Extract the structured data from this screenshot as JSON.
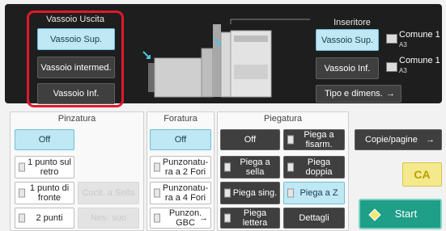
{
  "output_tray": {
    "title": "Vassoio Uscita",
    "options": [
      "Vassoio Sup.",
      "Vassoio intermed.",
      "Vassoio Inf."
    ],
    "selected": "Vassoio Sup."
  },
  "inserter": {
    "title": "Inseritore",
    "upper_button": "Vassoio Sup.",
    "upper_info": {
      "paper": "Comune 1",
      "size": "A3"
    },
    "lower_button": "Vassoio Inf.",
    "lower_info": {
      "paper": "Comune 1",
      "size": "A3"
    },
    "type_size_button": "Tipo e dimens."
  },
  "stapling": {
    "title": "Pinzatura",
    "off": "Off",
    "one_back": "1 punto sul retro",
    "one_front": "1 punto di fronte",
    "two_points": "2 punti",
    "saddle_disabled": "Cucit. a Sella",
    "none_disabled": "Nes- suo"
  },
  "punch": {
    "title": "Foratura",
    "off": "Off",
    "two_holes": "Punzonatu- ra a 2 Fori",
    "four_holes": "Punzonatu- ra a 4 Fori",
    "gbc": "Punzon. GBC"
  },
  "fold": {
    "title": "Piegatura",
    "off": "Off",
    "accordion": "Piega a fisarm.",
    "saddle": "Piega a sella",
    "double": "Piega doppia",
    "single": "Piega sing.",
    "z": "Piega a Z",
    "letter": "Piega lettera",
    "details": "Dettagli"
  },
  "actions": {
    "copies_pages": "Copie/pagine",
    "ca": "CA",
    "start": "Start"
  },
  "colors": {
    "selected": "#bfe7f4",
    "highlight_frame": "#e0182d",
    "start": "#1f9e88",
    "ca": "#f5e98d"
  }
}
